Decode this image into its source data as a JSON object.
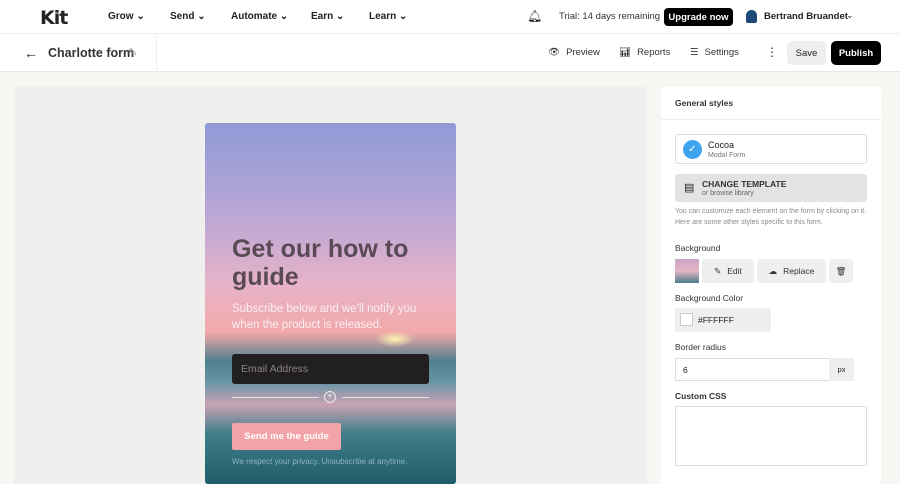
{
  "topnav": {
    "logo": "Kit",
    "items": [
      "Grow ⌄",
      "Send ⌄",
      "Automate ⌄",
      "Earn ⌄",
      "Learn ⌄"
    ],
    "trial": "Trial: 14 days remaining",
    "upgrade": "Upgrade now",
    "user": "Bertrand Bruandet"
  },
  "toolbar": {
    "title": "Charlotte form",
    "preview": "Preview",
    "reports": "Reports",
    "settings": "Settings",
    "save": "Save",
    "publish": "Publish"
  },
  "form": {
    "heading": "Get our how to guide",
    "subtitle": "Subscribe below and we'll notify you when the product is released.",
    "email_placeholder": "Email Address",
    "button": "Send me the guide",
    "privacy": "We respect your privacy. Unsubscribe at anytime."
  },
  "panel": {
    "header": "General styles",
    "template_name": "Cocoa",
    "template_type": "Modal Form",
    "change_template": "CHANGE TEMPLATE",
    "browse": "or browse library",
    "help": "You can customize each element on the form by clicking on it. Here are some other styles specific to this form.",
    "background_label": "Background",
    "edit": "Edit",
    "replace": "Replace",
    "bg_color_label": "Background Color",
    "bg_color": "#FFFFFF",
    "radius_label": "Border radius",
    "radius": "6",
    "radius_unit": "px",
    "css_label": "Custom CSS"
  }
}
